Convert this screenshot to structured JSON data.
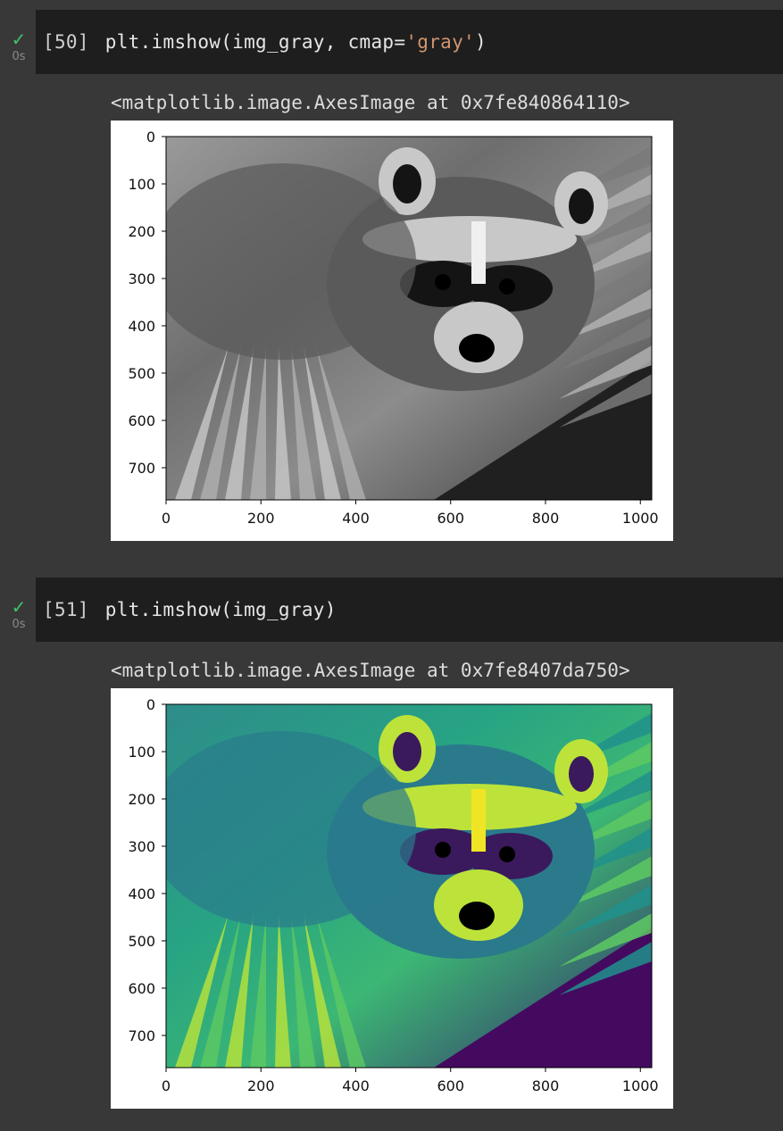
{
  "cells": [
    {
      "status_icon": "check-icon",
      "runtime": "0s",
      "exec_count": "[50]",
      "code_prefix": "plt.imshow(img_gray, cmap=",
      "code_string": "'gray'",
      "code_suffix": ")",
      "output_text": "<matplotlib.image.AxesImage at 0x7fe840864110>",
      "chart_data": {
        "type": "heatmap",
        "title": "",
        "colormap": "gray",
        "xlabel": "",
        "ylabel": "",
        "x_ticks": [
          "0",
          "200",
          "400",
          "600",
          "800",
          "1000"
        ],
        "y_ticks": [
          "0",
          "100",
          "200",
          "300",
          "400",
          "500",
          "600",
          "700"
        ],
        "xlim": [
          0,
          1024
        ],
        "ylim": [
          768,
          0
        ],
        "image_content": "raccoon face photo"
      }
    },
    {
      "status_icon": "check-icon",
      "runtime": "0s",
      "exec_count": "[51]",
      "code_prefix": "plt.imshow(img_gray)",
      "code_string": "",
      "code_suffix": "",
      "output_text": "<matplotlib.image.AxesImage at 0x7fe8407da750>",
      "chart_data": {
        "type": "heatmap",
        "title": "",
        "colormap": "viridis",
        "xlabel": "",
        "ylabel": "",
        "x_ticks": [
          "0",
          "200",
          "400",
          "600",
          "800",
          "1000"
        ],
        "y_ticks": [
          "0",
          "100",
          "200",
          "300",
          "400",
          "500",
          "600",
          "700"
        ],
        "xlim": [
          0,
          1024
        ],
        "ylim": [
          768,
          0
        ],
        "image_content": "raccoon face photo"
      }
    }
  ],
  "colors": {
    "page_bg": "#383838",
    "code_bg": "#1e1e1e",
    "check": "#3ec46d",
    "string": "#d0956e"
  }
}
